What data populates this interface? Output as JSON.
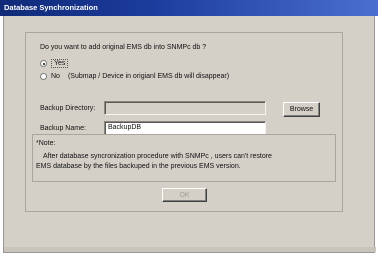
{
  "window": {
    "title": "Database Synchronization"
  },
  "question": "Do you want to add original EMS db into SNMPc db ?",
  "options": {
    "yes_label": "Yes",
    "no_label": "No",
    "no_note": "(Submap / Device in origianl EMS db will disappear)",
    "selected": "yes"
  },
  "backup": {
    "directory_label": "Backup Directory:",
    "directory_value": "",
    "browse_label": "Browse",
    "name_label": "Backup Name:",
    "name_value": "BackupDB"
  },
  "note": {
    "title": "*Note:",
    "line1": "After database syncronization procedure with SNMPc , users can't restore",
    "line2": "EMS database by the files backuped in the previous EMS version."
  },
  "ok_label": "OK"
}
